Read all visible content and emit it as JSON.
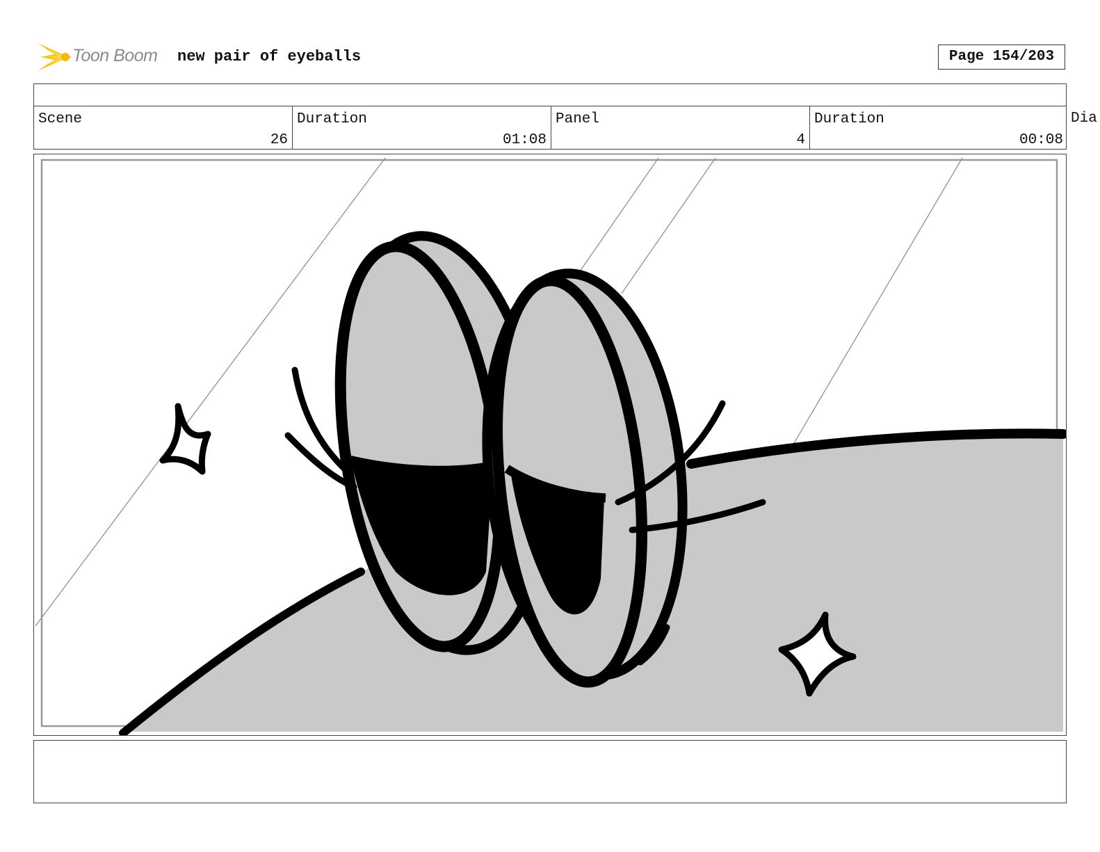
{
  "header": {
    "logo_text": "Toon Boom",
    "title": "new pair of eyeballs",
    "page_label": "Page 154/203"
  },
  "info": {
    "scene_label": "Scene",
    "scene_value": "26",
    "duration_label": "Duration",
    "duration_value": "01:08",
    "panel_label": "Panel",
    "panel_value": "4",
    "panel_duration_label": "Duration",
    "panel_duration_value": "00:08",
    "dialog_label_partial": "Dia"
  },
  "colors": {
    "logo_yellow": "#f5c518",
    "logo_text": "#8a8a8a",
    "fill_gray": "#c9c9c9",
    "ink": "#000000"
  },
  "drawing": {
    "subject": "two oval eyeballs with eyelashes on a gray surface, sparkles"
  }
}
